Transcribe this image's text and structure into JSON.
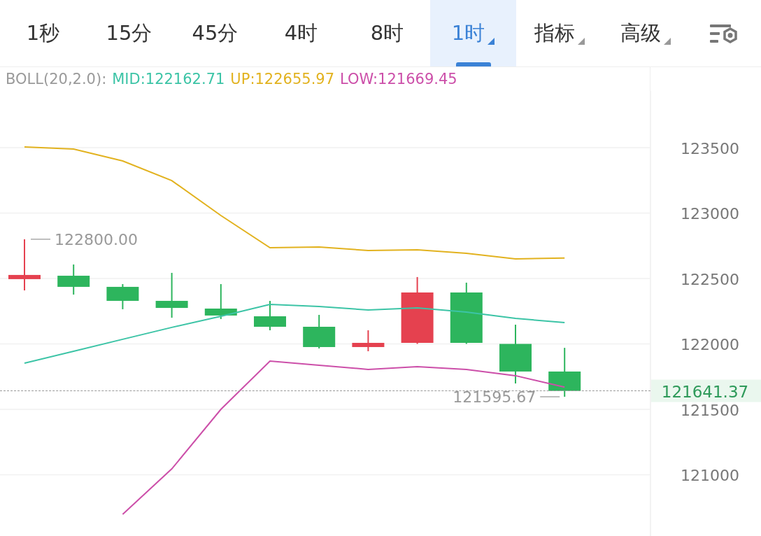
{
  "tabs": [
    {
      "label": "1秒",
      "selected": false,
      "dropdown": false
    },
    {
      "label": "15分",
      "selected": false,
      "dropdown": false
    },
    {
      "label": "45分",
      "selected": false,
      "dropdown": false
    },
    {
      "label": "4时",
      "selected": false,
      "dropdown": false
    },
    {
      "label": "8时",
      "selected": false,
      "dropdown": false
    },
    {
      "label": "1时",
      "selected": true,
      "dropdown": true
    },
    {
      "label": "指标",
      "selected": false,
      "dropdown": true
    },
    {
      "label": "高级",
      "selected": false,
      "dropdown": true
    }
  ],
  "legend": {
    "label": "BOLL(20,2.0):",
    "items": [
      "MID:122162.71",
      "UP:122655.97",
      "LOW:121669.45"
    ]
  },
  "chart": {
    "chart_data": {
      "type": "line",
      "ylim": [
        120532,
        123933
      ],
      "yticks": [
        121000,
        121500,
        122000,
        122500,
        123000,
        123500
      ],
      "grid": true,
      "series": [
        {
          "color": "#3cc4a6",
          "values": [
            121853,
            121944,
            122035,
            122126,
            122211,
            122302,
            122286,
            122259,
            122275,
            122243,
            122195,
            122163
          ]
        },
        {
          "color": "#e2b21f",
          "values": [
            123505,
            123489,
            123398,
            123248,
            122981,
            122735,
            122740,
            122714,
            122719,
            122692,
            122650,
            122656
          ]
        },
        {
          "color": "#cc4fa9",
          "values": [
            null,
            null,
            120698,
            121045,
            121500,
            121869,
            121837,
            121805,
            121826,
            121805,
            121757,
            121670
          ]
        }
      ],
      "annotations": [
        "122800.00",
        "121595.67"
      ]
    },
    "last_price": "121641.37"
  }
}
